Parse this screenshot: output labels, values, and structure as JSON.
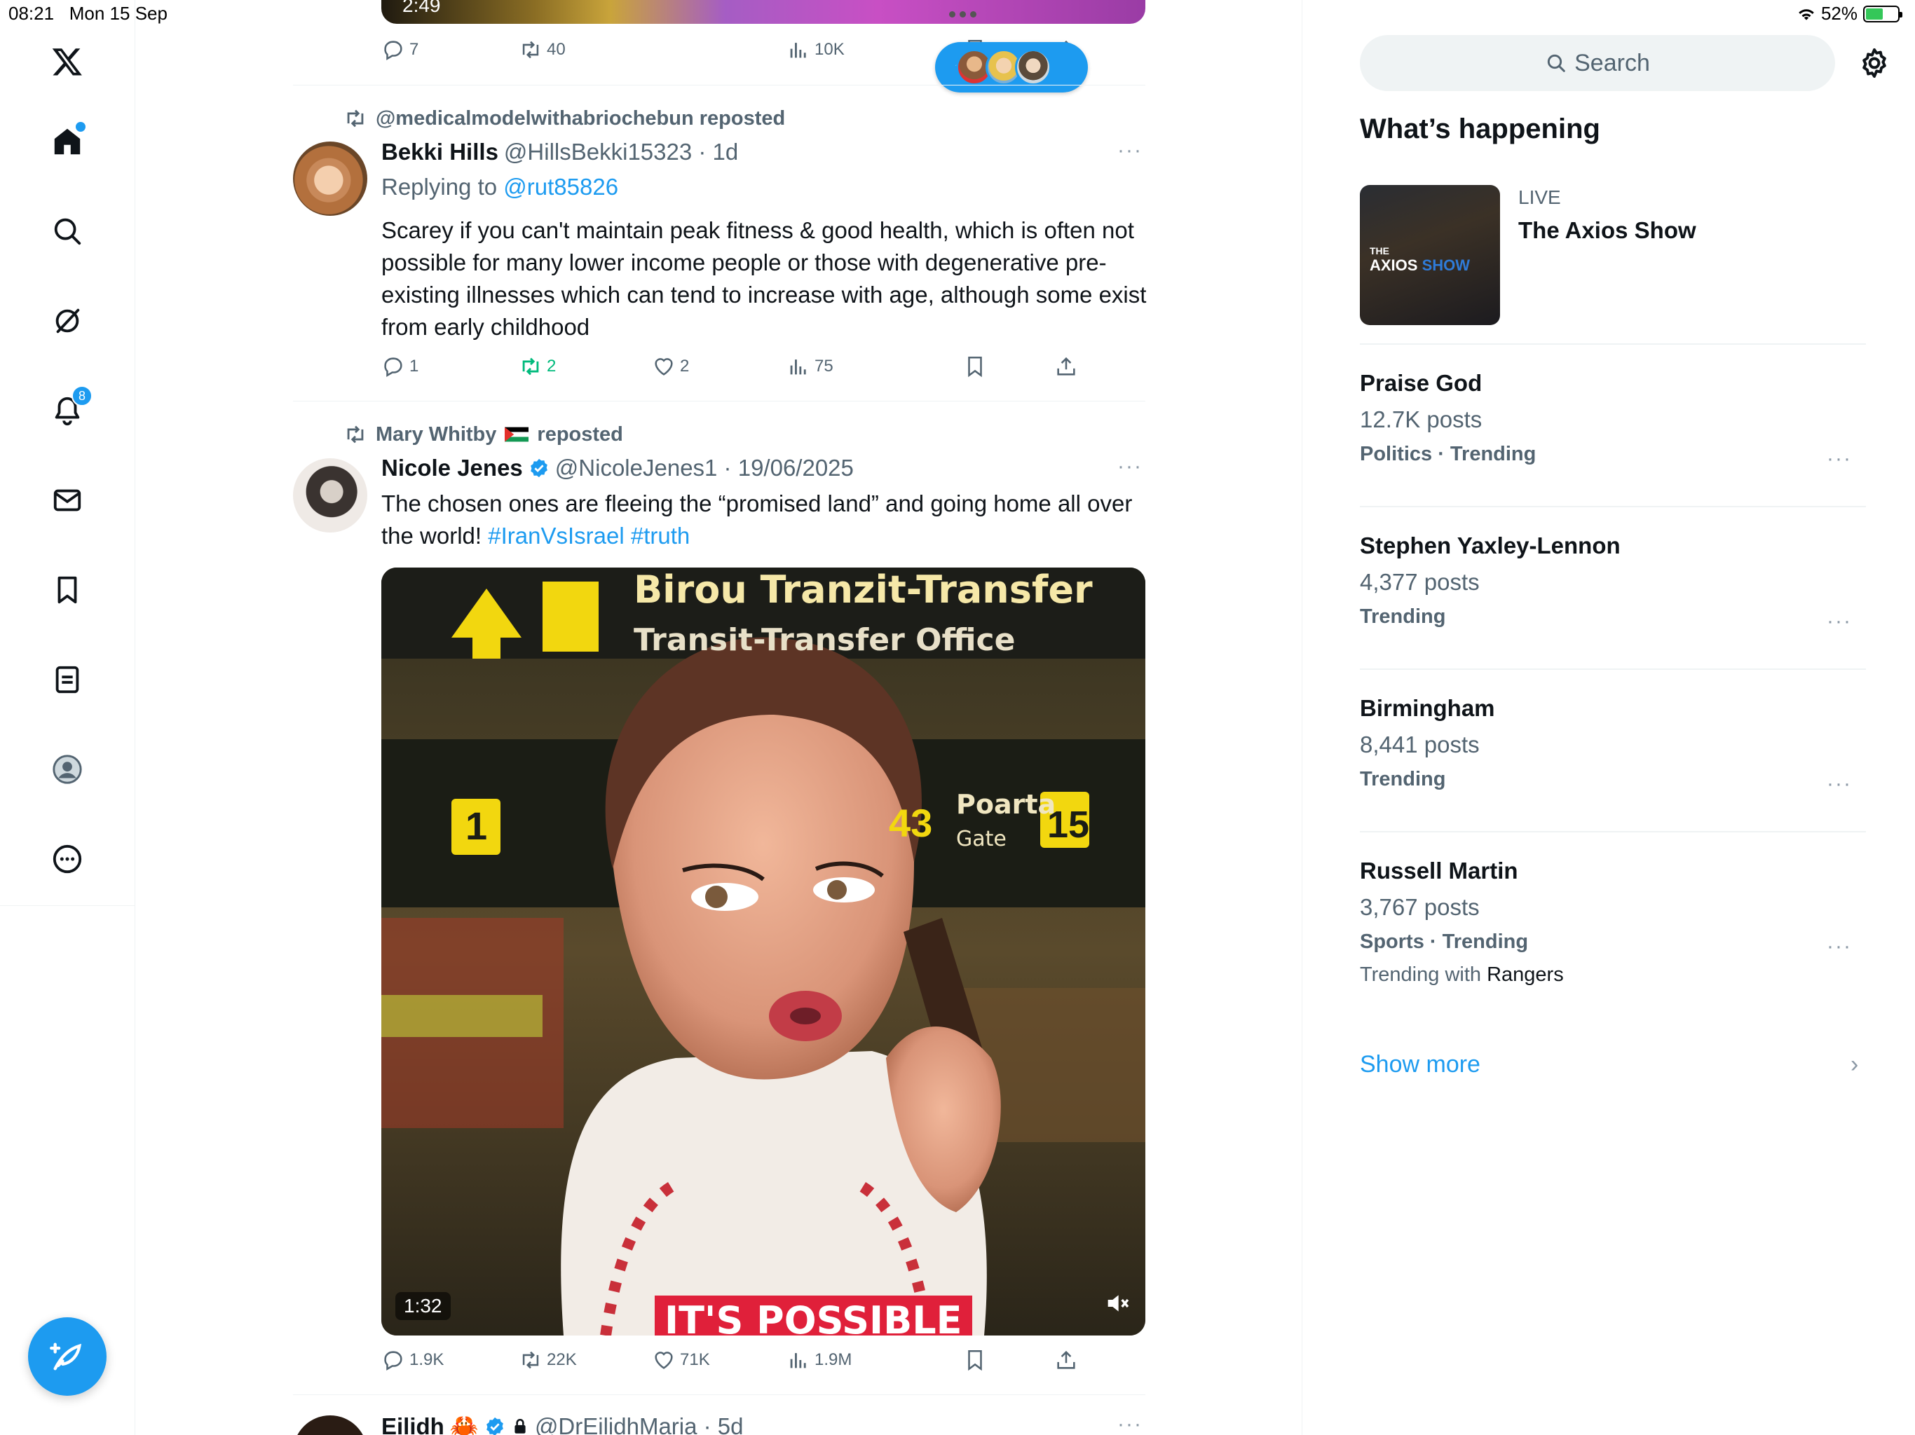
{
  "status_bar": {
    "time": "08:21",
    "date": "Mon 15 Sep",
    "battery": "52%"
  },
  "nav": {
    "notifications_badge": "8",
    "items": [
      "x-logo",
      "home",
      "explore",
      "grok",
      "notifications",
      "messages",
      "bookmarks",
      "lists",
      "profile",
      "more"
    ]
  },
  "new_posts_pill": {
    "arrow": "↑"
  },
  "top_post": {
    "video_time": "2:49",
    "stats": {
      "replies": "7",
      "reposts": "40",
      "views": "10K"
    }
  },
  "post1": {
    "repost_by": "@medicalmodelwithabriochebun reposted",
    "name": "Bekki Hills",
    "handle": "@HillsBekki15323 · 1d",
    "replying_prefix": "Replying to",
    "replying_handle": "@rut85826",
    "text": "Scarey if you can't maintain peak fitness & good health, which is often not possible for many lower income people or those with degenerative pre-existing illnesses which can tend to increase with age, although some exist from early childhood",
    "stats": {
      "replies": "1",
      "reposts": "2",
      "likes": "2",
      "views": "75"
    },
    "more": "···"
  },
  "post2": {
    "repost_by": "Mary Whitby",
    "repost_suffix": "reposted",
    "name": "Nicole Jenes",
    "handle": "@NicoleJenes1 · 19/06/2025",
    "text": "The chosen ones are fleeing the “promised land” and going home all over the world!",
    "tag1": "#IranVsIsrael",
    "tag2": "#truth",
    "video": {
      "sign_line1": "Birou Tranzit-Transfer",
      "sign_line2": "Transit-Transfer Office",
      "gate_word": "Poarta",
      "gate_sub": "Gate",
      "gate_number": "15",
      "gate_left": "43",
      "gate_one": "1",
      "caption": "IT'S POSSIBLE",
      "time": "1:32"
    },
    "stats": {
      "replies": "1.9K",
      "reposts": "22K",
      "likes": "71K",
      "views": "1.9M"
    },
    "more": "···"
  },
  "post3": {
    "name": "Eilidh",
    "emoji": "🦀",
    "handle": "@DrEilidhMaria · 5d",
    "more": "···"
  },
  "sidebar": {
    "search_placeholder": "Search",
    "title": "What’s happening",
    "live": {
      "label": "LIVE",
      "title": "The Axios Show",
      "thumb_small": "THE",
      "thumb_brand": "AXIOS",
      "thumb_brand2": "SHOW"
    },
    "trends": [
      {
        "name": "Praise God",
        "count": "12.7K posts",
        "meta": "Politics · Trending"
      },
      {
        "name": "Stephen Yaxley-Lennon",
        "count": "4,377 posts",
        "meta": "Trending"
      },
      {
        "name": "Birmingham",
        "count": "8,441 posts",
        "meta": "Trending"
      },
      {
        "name": "Russell Martin",
        "count": "3,767 posts",
        "meta": "Sports · Trending",
        "with_prefix": "Trending with",
        "with_value": "Rangers"
      }
    ],
    "trend_more": "···",
    "show_more": "Show more",
    "show_more_chevron": "›"
  },
  "colors": {
    "accent": "#1d9bf0",
    "repost_green": "#00ba7c",
    "muted": "#536471",
    "border": "#eff3f4"
  }
}
